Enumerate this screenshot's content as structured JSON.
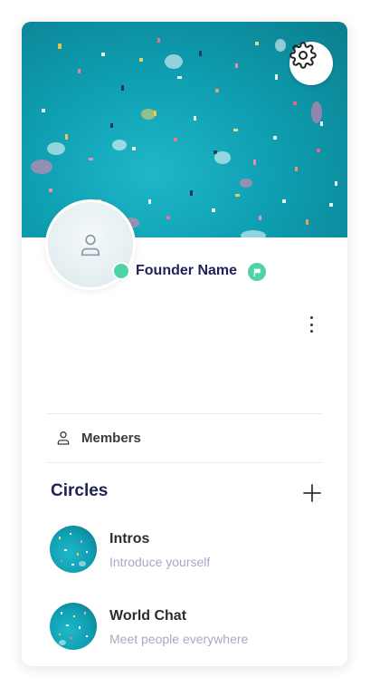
{
  "profile": {
    "founder_name": "Founder Name",
    "online_color": "#4fd3a4",
    "settings_icon": "gear-icon",
    "avatar_icon": "user-outline-icon",
    "badge_icon": "flag-icon",
    "more_icon": "vertical-ellipsis-icon"
  },
  "members": {
    "label": "Members",
    "icon": "user-outline-icon"
  },
  "circles": {
    "title": "Circles",
    "add_icon": "plus-icon",
    "items": [
      {
        "name": "Intros",
        "description": "Introduce yourself"
      },
      {
        "name": "World Chat",
        "description": "Meet people everywhere"
      }
    ]
  },
  "colors": {
    "accent": "#4fd3a4",
    "title": "#1e2257",
    "muted": "#a7a9c8"
  }
}
